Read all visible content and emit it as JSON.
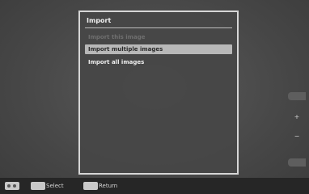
{
  "dialog": {
    "title": "Import",
    "items": [
      {
        "label": "Import this image",
        "state": "disabled"
      },
      {
        "label": "Import multiple images",
        "state": "selected"
      },
      {
        "label": "Import all images",
        "state": "normal"
      }
    ]
  },
  "footer": {
    "select_label": "Select",
    "return_label": "Return"
  },
  "colors": {
    "highlight": "#b8b8b8",
    "dialog_border": "#d6d6d6"
  },
  "icons": [
    "memory-card-icon",
    "enter-key-icon",
    "back-key-icon",
    "zoom-plus-icon",
    "zoom-minus-icon"
  ]
}
